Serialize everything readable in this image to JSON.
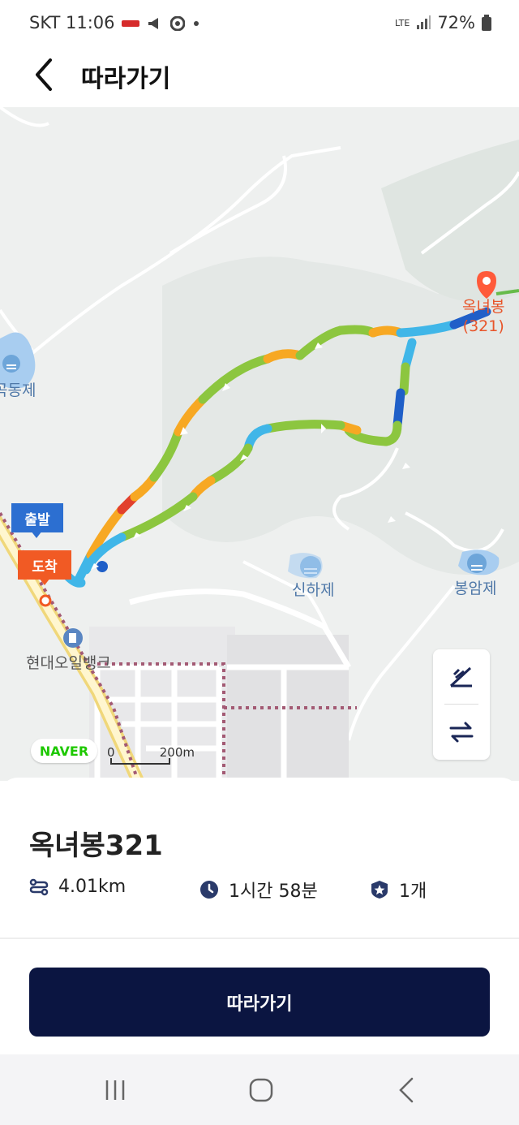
{
  "status_bar": {
    "time": "SKT 11:06",
    "network": "LTE",
    "battery": "72%"
  },
  "app_bar": {
    "back_icon": "chevron-left-icon",
    "title": "따라가기"
  },
  "map": {
    "labels": {
      "peak_name": "옥녀봉",
      "peak_height": "(321)",
      "reservoir_left": "곡동제",
      "reservoir_mid": "신하제",
      "reservoir_right": "봉암제",
      "gas_station": "현대오일뱅크"
    },
    "markers": {
      "start": "출발",
      "end": "도착"
    },
    "logo": "NAVER",
    "scale": {
      "zero": "0",
      "distance": "200m"
    },
    "controls": [
      "mountain-slope-icon",
      "swap-arrows-icon"
    ]
  },
  "route": {
    "name": "옥녀봉321",
    "distance": "4.01km",
    "duration": "1시간 58분",
    "peaks_count": "1개"
  },
  "action": {
    "follow_label": "따라가기"
  },
  "colors": {
    "primary_button": "#0b1541",
    "start_marker": "#2c6fd1",
    "end_marker": "#f15a24",
    "route_green": "#8cc63f",
    "route_orange": "#f7a823",
    "route_red": "#e2402d",
    "route_light_blue": "#40b6e8",
    "route_dark_blue": "#1f5fc8"
  },
  "system_nav": [
    "recent-apps-icon",
    "home-icon",
    "back-icon"
  ]
}
